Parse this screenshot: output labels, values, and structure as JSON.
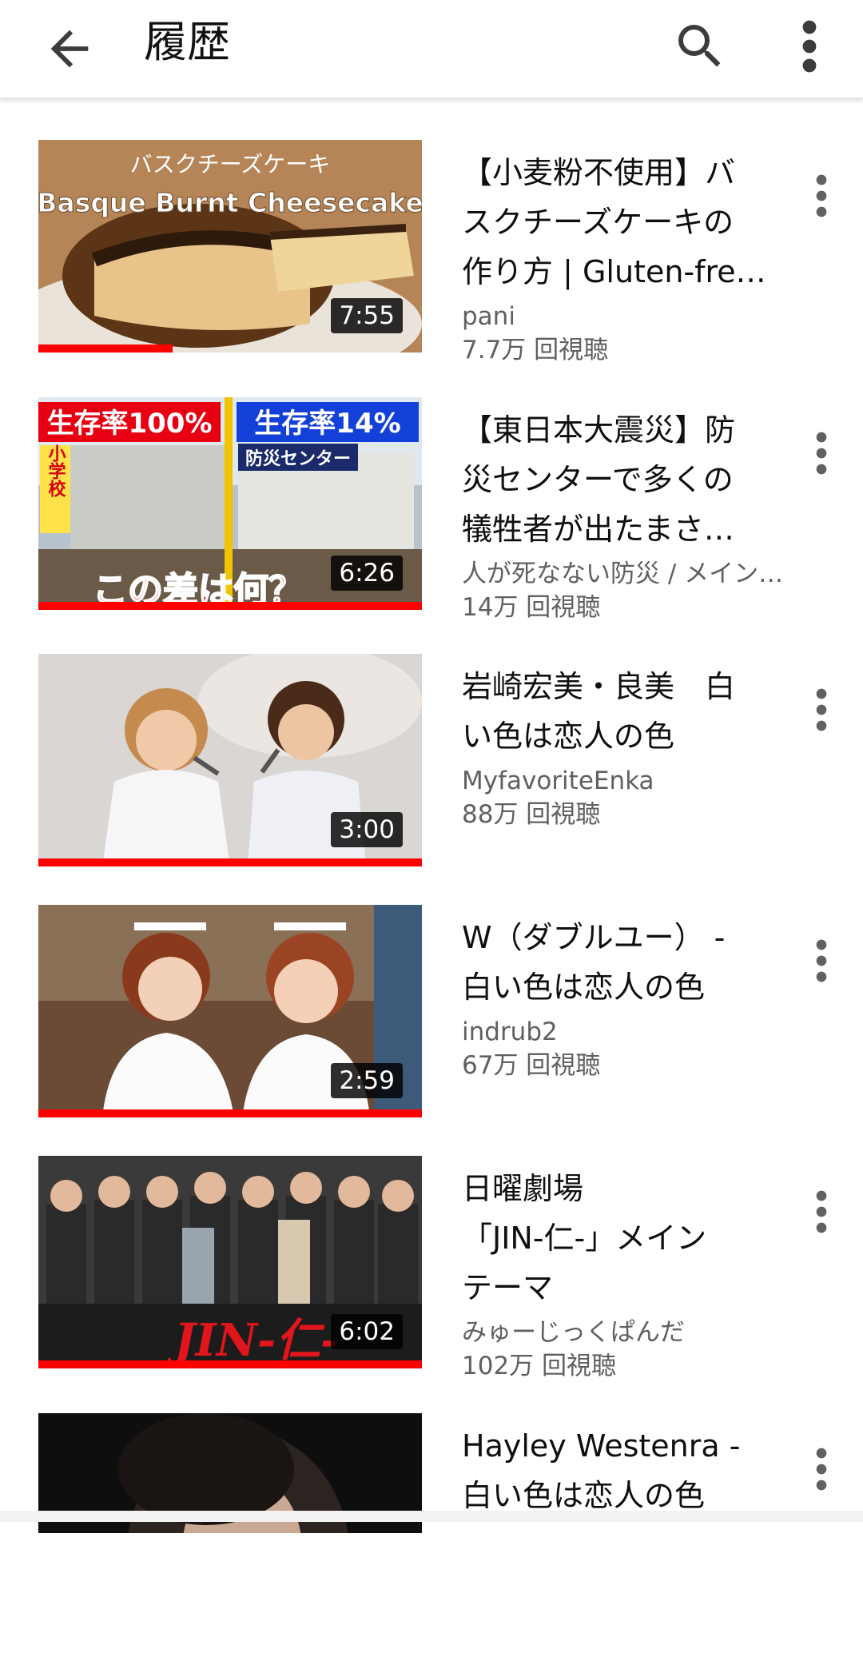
{
  "header": {
    "title": "履歴"
  },
  "videos": [
    {
      "title": "【小麦粉不使用】バ\nスクチーズケーキの\n作り方 | Gluten-fre…",
      "channel": "pani",
      "views": "7.7万 回視聴",
      "duration": "7:55",
      "thumb_text_top": "バスクチーズケーキ",
      "thumb_text_main": "Basque Burnt Cheesecake",
      "watched_fraction": 0.35
    },
    {
      "title": "【東日本大震災】防\n災センターで多くの\n犠牲者が出たまさ…",
      "channel": "人が死なない防災 / メイン…",
      "views": "14万 回視聴",
      "duration": "6:26",
      "thumb_label_left": "生存率100%",
      "thumb_label_right": "生存率14%",
      "thumb_sub_left": "小学校",
      "thumb_sub_right": "防災センター",
      "thumb_caption": "この差は何？",
      "watched_fraction": 1.0
    },
    {
      "title": "岩崎宏美・良美　白\nい色は恋人の色",
      "channel": "MyfavoriteEnka",
      "views": "88万 回視聴",
      "duration": "3:00",
      "watched_fraction": 1.0
    },
    {
      "title": "W（ダブルユー） -\n白い色は恋人の色",
      "channel": "indrub2",
      "views": "67万 回視聴",
      "duration": "2:59",
      "watched_fraction": 1.0
    },
    {
      "title": "日曜劇場\n「JIN-仁-」メイン\nテーマ",
      "channel": "みゅーじっくぱんだ",
      "views": "102万 回視聴",
      "duration": "6:02",
      "thumb_logo": "JIN-仁-",
      "watched_fraction": 1.0
    },
    {
      "title": "Hayley Westenra -\n白い色は恋人の色",
      "channel": "",
      "views": "",
      "duration": "",
      "watched_fraction": 0
    }
  ]
}
